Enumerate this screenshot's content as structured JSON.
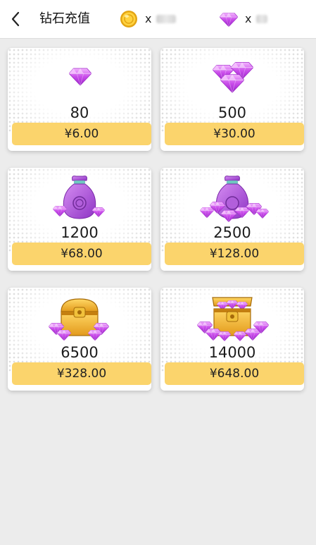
{
  "header": {
    "title": "钻石充值",
    "coin_balance_prefix": "x",
    "gem_balance_prefix": "x"
  },
  "packages": [
    {
      "amount": "80",
      "price": "¥6.00",
      "icon": "single-diamond-icon"
    },
    {
      "amount": "500",
      "price": "¥30.00",
      "icon": "diamond-cluster-icon"
    },
    {
      "amount": "1200",
      "price": "¥68.00",
      "icon": "diamond-bag-icon"
    },
    {
      "amount": "2500",
      "price": "¥128.00",
      "icon": "diamond-bag-pile-icon"
    },
    {
      "amount": "6500",
      "price": "¥328.00",
      "icon": "treasure-chest-icon"
    },
    {
      "amount": "14000",
      "price": "¥648.00",
      "icon": "treasure-chest-overflow-icon"
    }
  ],
  "colors": {
    "price_button": "#fbd46c",
    "diamond": "#c34ee6",
    "background": "#ececec"
  }
}
